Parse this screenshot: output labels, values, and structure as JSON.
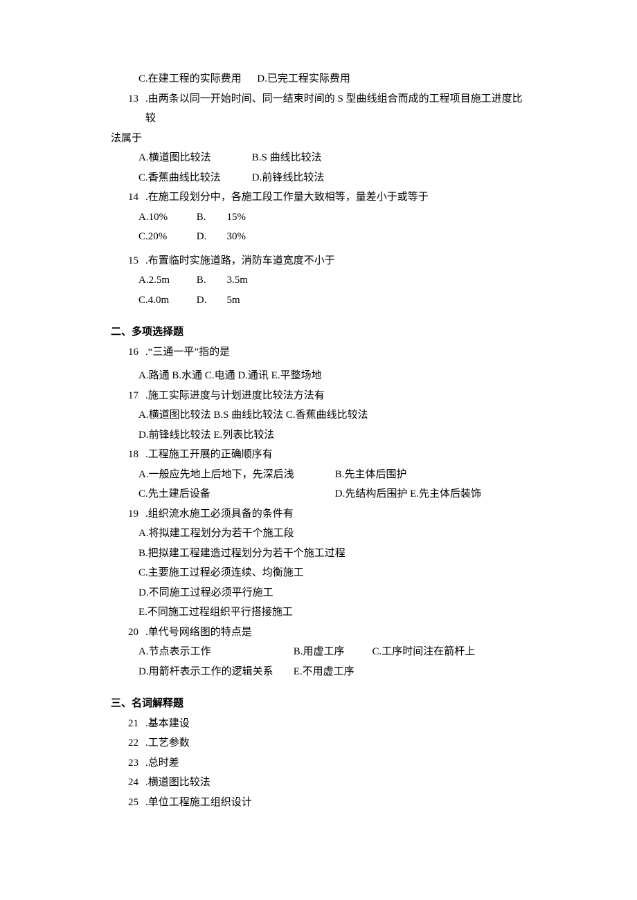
{
  "q12options": {
    "c": "C.在建工程的实际费用",
    "d": "D.已完工程实际费用"
  },
  "q13": {
    "num": "13",
    "stemA": ".由两条以同一开始时间、同一结束时间的 S 型曲线组合而成的工程项目施工进度比较",
    "stemB": "法属于",
    "a": "A.横道图比较法",
    "b": "B.S 曲线比较法",
    "c": "C.香蕉曲线比较法",
    "d": "D.前锋线比较法"
  },
  "q14": {
    "num": "14",
    "stem": ".在施工段划分中，各施工段工作量大致相等，量差小于或等于",
    "a": "A.10%",
    "bL": "B.",
    "bV": "15%",
    "c": "C.20%",
    "dL": "D.",
    "dV": "30%"
  },
  "q15": {
    "num": "15",
    "stem": ".布置临时实施道路，消防车道宽度不小于",
    "a": "A.2.5m",
    "bL": "B.",
    "bV": "3.5m",
    "c": "C.4.0m",
    "dL": "D.",
    "dV": "5m"
  },
  "sec2": "二、多项选择题",
  "q16": {
    "num": "16",
    "stem": ".“三通一平”指的是",
    "opts": "A.路通 B.水通 C.电通 D.通讯 E.平整场地"
  },
  "q17": {
    "num": "17",
    "stem": ".施工实际进度与计划进度比较法方法有",
    "line1": "A.横道图比较法 B.S 曲线比较法 C.香蕉曲线比较法",
    "line2": "D.前锋线比较法 E.列表比较法"
  },
  "q18": {
    "num": "18",
    "stem": ".工程施工开展的正确顺序有",
    "a": "A.一般应先地上后地下，先深后浅",
    "b": "B.先主体后围护",
    "c": "C.先土建后设备",
    "d": "D.先结构后围护 E.先主体后装饰"
  },
  "q19": {
    "num": "19",
    "stem": ".组织流水施工必须具备的条件有",
    "a": "A.将拟建工程划分为若干个施工段",
    "b": "B.把拟建工程建造过程划分为若干个施工过程",
    "c": "C.主要施工过程必须连续、均衡施工",
    "d": "D.不同施工过程必须平行施工",
    "e": "E.不同施工过程组织平行搭接施工"
  },
  "q20": {
    "num": "20",
    "stem": ".单代号网络图的特点是",
    "a": "A.节点表示工作",
    "b": "B.用虚工序",
    "c": "C.工序时间注在箭杆上",
    "d": "D.用箭杆表示工作的逻辑关系",
    "e": "E.不用虚工序"
  },
  "sec3": "三、名词解释题",
  "q21": {
    "num": "21",
    "stem": ".基本建设"
  },
  "q22": {
    "num": "22",
    "stem": ".工艺参数"
  },
  "q23": {
    "num": "23",
    "stem": ".总时差"
  },
  "q24": {
    "num": "24",
    "stem": ".横道图比较法"
  },
  "q25": {
    "num": "25",
    "stem": ".单位工程施工组织设计"
  }
}
